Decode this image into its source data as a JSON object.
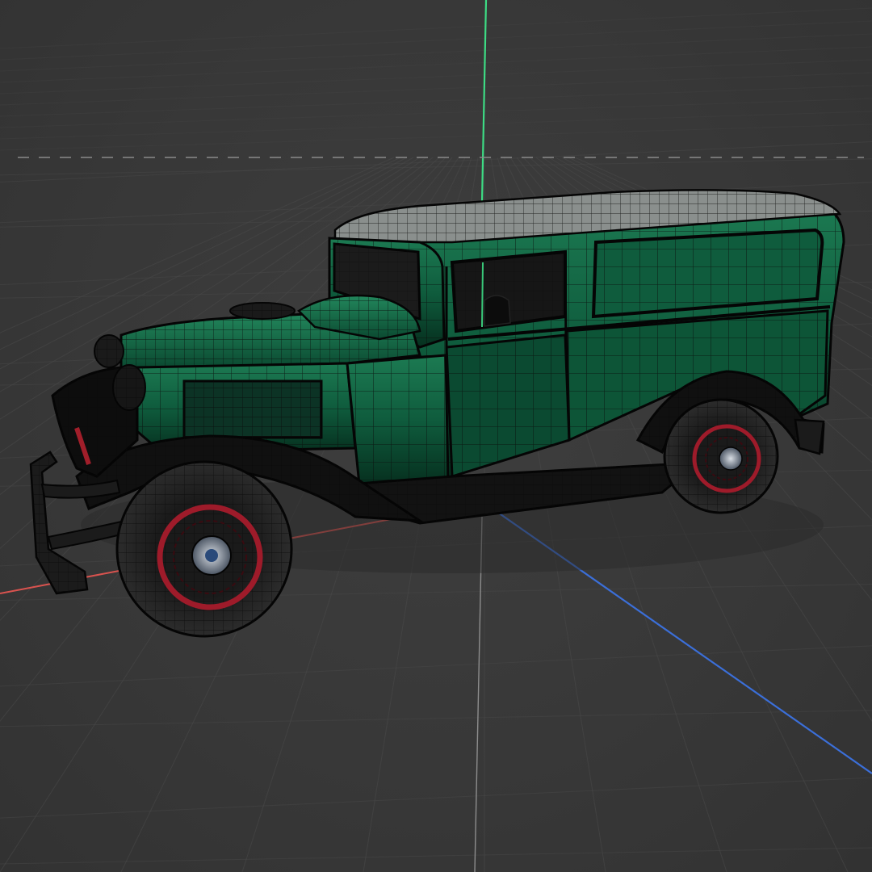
{
  "viewport": {
    "view": "perspective",
    "shading": "solid-wireframe",
    "grid": true,
    "axes": {
      "x": {
        "color": "#d9534f"
      },
      "y": {
        "color": "#3ddc84"
      },
      "z": {
        "color": "#3b6fd9"
      }
    }
  },
  "model": {
    "object": "vintage-panel-van",
    "body_color": "#0f5c3d",
    "roof_color": "#8a8f8d",
    "fender_color": "#0b0b0b",
    "wheel_rim_color": "#9e1b2a",
    "wire_color": "#111111"
  }
}
